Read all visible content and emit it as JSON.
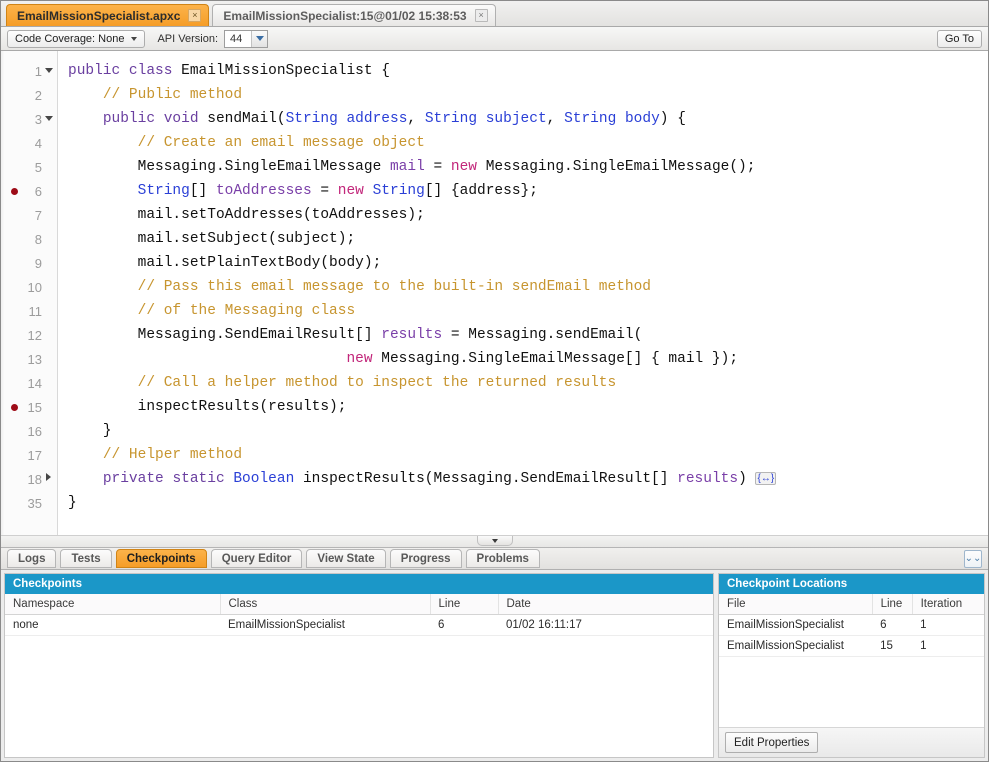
{
  "window": {
    "tabs": [
      {
        "label": "EmailMissionSpecialist.apxc",
        "active": true,
        "close": "×"
      },
      {
        "label": "EmailMissionSpecialist:15@01/02 15:38:53",
        "active": false,
        "close": "×"
      }
    ]
  },
  "toolbar": {
    "code_coverage_label": "Code Coverage: None",
    "api_version_label": "API Version:",
    "api_version_value": "44",
    "go_to_label": "Go To"
  },
  "editor": {
    "lines": [
      {
        "num": "1",
        "breakpoint": false,
        "fold": "down",
        "indent": 0,
        "tokens": [
          {
            "t": "kw",
            "s": "public"
          },
          {
            "t": "pln",
            "s": " "
          },
          {
            "t": "kw",
            "s": "class"
          },
          {
            "t": "pln",
            "s": " EmailMissionSpecialist {"
          }
        ]
      },
      {
        "num": "2",
        "breakpoint": false,
        "fold": "",
        "indent": 1,
        "tokens": [
          {
            "t": "cmt",
            "s": "// Public method"
          }
        ]
      },
      {
        "num": "3",
        "breakpoint": false,
        "fold": "down",
        "indent": 1,
        "tokens": [
          {
            "t": "kw",
            "s": "public"
          },
          {
            "t": "pln",
            "s": " "
          },
          {
            "t": "kw",
            "s": "void"
          },
          {
            "t": "pln",
            "s": " sendMail("
          },
          {
            "t": "type",
            "s": "String"
          },
          {
            "t": "pln",
            "s": " "
          },
          {
            "t": "type",
            "s": "address"
          },
          {
            "t": "pln",
            "s": ", "
          },
          {
            "t": "type",
            "s": "String"
          },
          {
            "t": "pln",
            "s": " "
          },
          {
            "t": "type",
            "s": "subject"
          },
          {
            "t": "pln",
            "s": ", "
          },
          {
            "t": "type",
            "s": "String"
          },
          {
            "t": "pln",
            "s": " "
          },
          {
            "t": "type",
            "s": "body"
          },
          {
            "t": "pln",
            "s": ") {"
          }
        ]
      },
      {
        "num": "4",
        "breakpoint": false,
        "fold": "",
        "indent": 2,
        "tokens": [
          {
            "t": "cmt",
            "s": "// Create an email message object"
          }
        ]
      },
      {
        "num": "5",
        "breakpoint": false,
        "fold": "",
        "indent": 2,
        "tokens": [
          {
            "t": "pln",
            "s": "Messaging.SingleEmailMessage "
          },
          {
            "t": "var",
            "s": "mail"
          },
          {
            "t": "pln",
            "s": " = "
          },
          {
            "t": "new",
            "s": "new"
          },
          {
            "t": "pln",
            "s": " Messaging.SingleEmailMessage();"
          }
        ]
      },
      {
        "num": "6",
        "breakpoint": true,
        "fold": "",
        "indent": 2,
        "tokens": [
          {
            "t": "type",
            "s": "String"
          },
          {
            "t": "pln",
            "s": "[] "
          },
          {
            "t": "var",
            "s": "toAddresses"
          },
          {
            "t": "pln",
            "s": " = "
          },
          {
            "t": "new",
            "s": "new"
          },
          {
            "t": "pln",
            "s": " "
          },
          {
            "t": "type",
            "s": "String"
          },
          {
            "t": "pln",
            "s": "[] {address};"
          }
        ]
      },
      {
        "num": "7",
        "breakpoint": false,
        "fold": "",
        "indent": 2,
        "tokens": [
          {
            "t": "pln",
            "s": "mail.setToAddresses(toAddresses);"
          }
        ]
      },
      {
        "num": "8",
        "breakpoint": false,
        "fold": "",
        "indent": 2,
        "tokens": [
          {
            "t": "pln",
            "s": "mail.setSubject(subject);"
          }
        ]
      },
      {
        "num": "9",
        "breakpoint": false,
        "fold": "",
        "indent": 2,
        "tokens": [
          {
            "t": "pln",
            "s": "mail.setPlainTextBody(body);"
          }
        ]
      },
      {
        "num": "10",
        "breakpoint": false,
        "fold": "",
        "indent": 2,
        "tokens": [
          {
            "t": "cmt",
            "s": "// Pass this email message to the built-in sendEmail method"
          }
        ]
      },
      {
        "num": "11",
        "breakpoint": false,
        "fold": "",
        "indent": 2,
        "tokens": [
          {
            "t": "cmt",
            "s": "// of the Messaging class"
          }
        ]
      },
      {
        "num": "12",
        "breakpoint": false,
        "fold": "",
        "indent": 2,
        "tokens": [
          {
            "t": "pln",
            "s": "Messaging.SendEmailResult[] "
          },
          {
            "t": "var",
            "s": "results"
          },
          {
            "t": "pln",
            "s": " = Messaging.sendEmail("
          }
        ]
      },
      {
        "num": "13",
        "breakpoint": false,
        "fold": "",
        "indent": 8,
        "tokens": [
          {
            "t": "new",
            "s": "new"
          },
          {
            "t": "pln",
            "s": " Messaging.SingleEmailMessage[] { mail });"
          }
        ]
      },
      {
        "num": "14",
        "breakpoint": false,
        "fold": "",
        "indent": 2,
        "tokens": [
          {
            "t": "cmt",
            "s": "// Call a helper method to inspect the returned results"
          }
        ]
      },
      {
        "num": "15",
        "breakpoint": true,
        "fold": "",
        "indent": 2,
        "tokens": [
          {
            "t": "pln",
            "s": "inspectResults(results);"
          }
        ]
      },
      {
        "num": "16",
        "breakpoint": false,
        "fold": "",
        "indent": 1,
        "tokens": [
          {
            "t": "pln",
            "s": "}"
          }
        ]
      },
      {
        "num": "17",
        "breakpoint": false,
        "fold": "",
        "indent": 1,
        "tokens": [
          {
            "t": "cmt",
            "s": "// Helper method"
          }
        ]
      },
      {
        "num": "18",
        "breakpoint": false,
        "fold": "right",
        "indent": 1,
        "tokens": [
          {
            "t": "kw",
            "s": "private"
          },
          {
            "t": "pln",
            "s": " "
          },
          {
            "t": "kw",
            "s": "static"
          },
          {
            "t": "pln",
            "s": " "
          },
          {
            "t": "type",
            "s": "Boolean"
          },
          {
            "t": "pln",
            "s": " inspectResults(Messaging.SendEmailResult[] "
          },
          {
            "t": "var",
            "s": "results"
          },
          {
            "t": "pln",
            "s": ") "
          },
          {
            "t": "foldbox",
            "s": "{↔}"
          }
        ]
      },
      {
        "num": "35",
        "breakpoint": false,
        "fold": "",
        "indent": 0,
        "tokens": [
          {
            "t": "pln",
            "s": "}"
          }
        ]
      }
    ]
  },
  "bottom_tabs": [
    {
      "label": "Logs",
      "active": false
    },
    {
      "label": "Tests",
      "active": false
    },
    {
      "label": "Checkpoints",
      "active": true
    },
    {
      "label": "Query Editor",
      "active": false
    },
    {
      "label": "View State",
      "active": false
    },
    {
      "label": "Progress",
      "active": false
    },
    {
      "label": "Problems",
      "active": false
    }
  ],
  "collapse_icon": "⌄⌄",
  "checkpoints_panel": {
    "title": "Checkpoints",
    "columns": [
      "Namespace",
      "Class",
      "Line",
      "Date"
    ],
    "rows": [
      [
        "none",
        "EmailMissionSpecialist",
        "6",
        "01/02 16:11:17"
      ]
    ]
  },
  "locations_panel": {
    "title": "Checkpoint Locations",
    "columns": [
      "File",
      "Line",
      "Iteration"
    ],
    "rows": [
      [
        "EmailMissionSpecialist",
        "6",
        "1"
      ],
      [
        "EmailMissionSpecialist",
        "15",
        "1"
      ]
    ],
    "edit_properties_label": "Edit Properties"
  },
  "colors": {
    "tab_active": "#f7a73a",
    "panel_header": "#1b97c8",
    "breakpoint": "#9d0b17",
    "comment": "#c7952f",
    "keyword": "#6a3fa0",
    "type": "#2a3fd6",
    "new_keyword": "#c2267a"
  }
}
